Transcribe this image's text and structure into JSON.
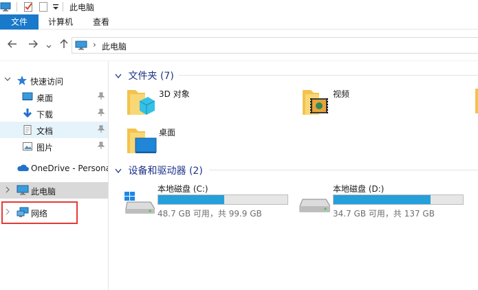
{
  "window": {
    "title": "此电脑"
  },
  "ribbon": {
    "tabs": [
      "文件",
      "计算机",
      "查看"
    ]
  },
  "address": {
    "location": "此电脑"
  },
  "nav_pane": {
    "quick_access": "快速访问",
    "items": [
      {
        "label": "桌面",
        "icon": "desktop-icon",
        "pinned": true
      },
      {
        "label": "下载",
        "icon": "download-icon",
        "pinned": true
      },
      {
        "label": "文档",
        "icon": "document-icon",
        "pinned": true
      },
      {
        "label": "图片",
        "icon": "pictures-icon",
        "pinned": true
      }
    ],
    "onedrive": "OneDrive - Persona",
    "this_pc": "此电脑",
    "network": "网络"
  },
  "content": {
    "folders_header": "文件夹 (7)",
    "folders": [
      {
        "name": "3D 对象",
        "icon": "3d-objects-icon"
      },
      {
        "name": "视频",
        "icon": "videos-icon"
      },
      {
        "name": "桌面",
        "icon": "desktop-folder-icon"
      }
    ],
    "devices_header": "设备和驱动器 (2)",
    "drives": [
      {
        "name": "本地磁盘 (C:)",
        "free_text": "48.7 GB 可用，共 99.9 GB",
        "used_fraction": 0.51,
        "icon": "windows-drive-icon"
      },
      {
        "name": "本地磁盘 (D:)",
        "free_text": "34.7 GB 可用，共 137 GB",
        "used_fraction": 0.75,
        "icon": "hard-drive-icon"
      }
    ]
  },
  "colors": {
    "accent": "#1979ca",
    "drive_bar": "#26a0da",
    "highlight_box": "#e53935",
    "group_header": "#1e3287"
  }
}
